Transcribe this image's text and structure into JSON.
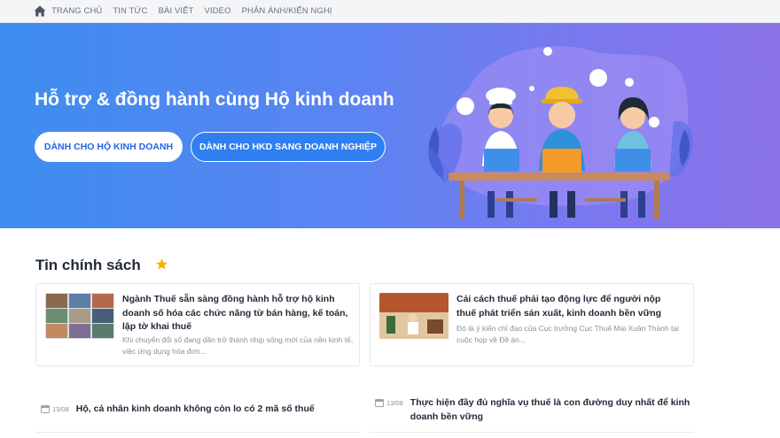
{
  "nav": {
    "items": [
      "TRANG CHỦ",
      "TIN TỨC",
      "BÀI VIẾT",
      "VIDEO",
      "PHẢN ÁNH/KIẾN NGHỊ"
    ]
  },
  "hero": {
    "title": "Hỗ trợ & đồng hành cùng Hộ kinh doanh",
    "btn_primary": "DÀNH CHO HỘ KINH DOANH",
    "btn_secondary": "DÀNH CHO HKD SANG DOANH NGHIỆP"
  },
  "news": {
    "title": "Tin chính sách",
    "cards": [
      {
        "title": "Ngành Thuế sẵn sàng đồng hành hỗ trợ hộ kinh doanh số hóa các chức năng từ bán hàng, kế toán, lập tờ khai thuế",
        "desc": "Khi chuyển đổi số đang dần trở thành nhịp sống mới của nền kinh tế, việc ứng dụng hóa đơn..."
      },
      {
        "title": "Cải cách thuế phải tạo động lực để người nộp thuế phát triển sản xuất, kinh doanh bền vững",
        "desc": "Đó là ý kiến chỉ đạo của Cục trưởng Cục Thuế Mai Xuân Thành tại cuộc họp về Đề án..."
      }
    ],
    "mini": [
      {
        "date": "13/08",
        "title": "Hộ, cá nhân kinh doanh không còn lo có 2 mã số thuế"
      },
      {
        "date": "13/08",
        "title": "Thực hiện đầy đủ nghĩa vụ thuế là con đường duy nhất để kinh doanh bền vững"
      }
    ]
  },
  "colors": {
    "hero_start": "#3d8df0",
    "hero_end": "#8c73ea",
    "accent": "#2563eb",
    "star": "#f5b301"
  },
  "icons": [
    "home-icon",
    "star-icon",
    "calendar-icon"
  ]
}
